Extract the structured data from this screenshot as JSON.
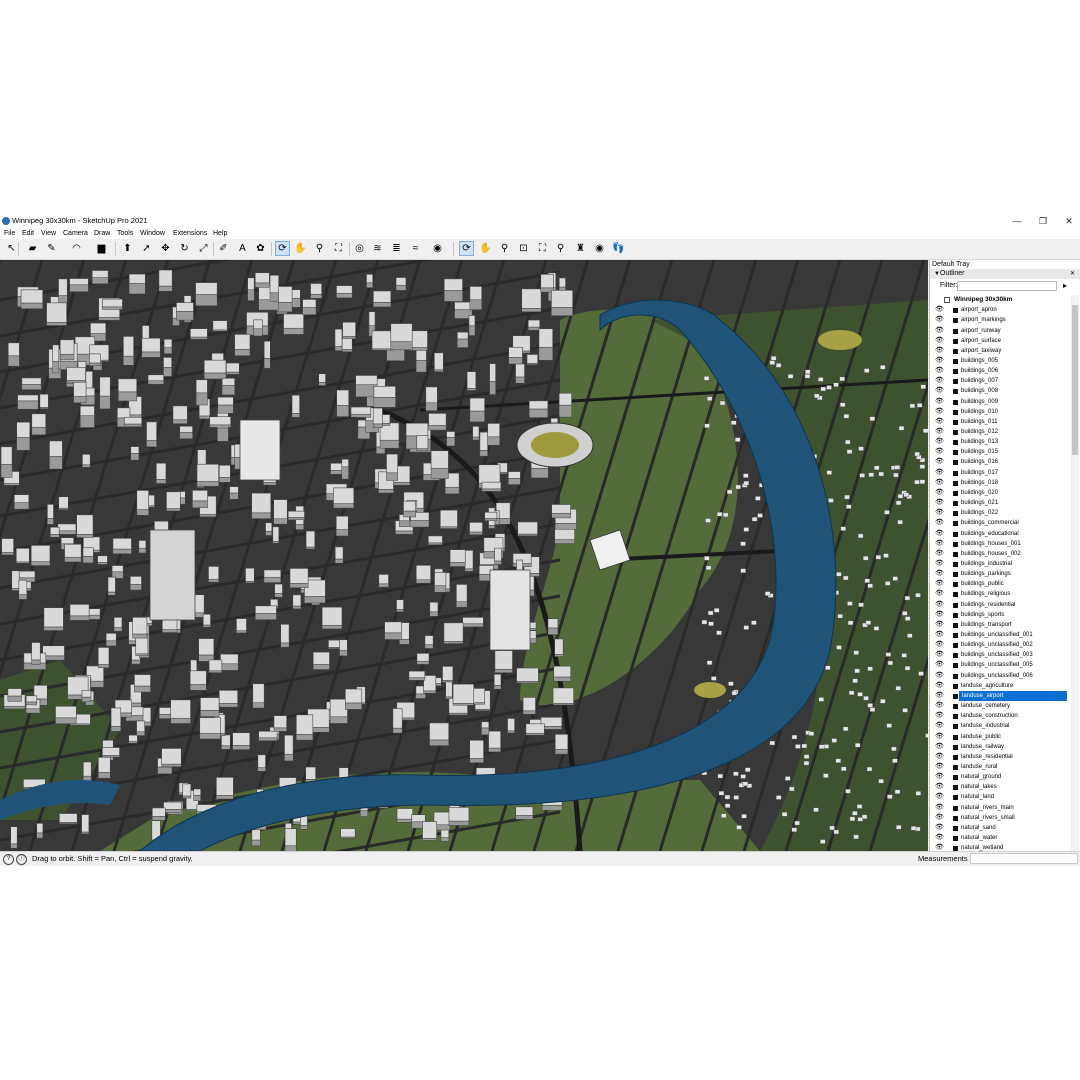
{
  "window": {
    "title": "Winnipeg 30x30km - SketchUp Pro 2021",
    "minimize_glyph": "—",
    "maximize_glyph": "❐",
    "close_glyph": "✕"
  },
  "menu": [
    "File",
    "Edit",
    "View",
    "Camera",
    "Draw",
    "Tools",
    "Window",
    "Extensions",
    "Help"
  ],
  "toolbar": {
    "tools": [
      {
        "name": "select-icon",
        "glyph": "↖"
      },
      {
        "name": "eraser-icon",
        "glyph": "▰"
      },
      {
        "name": "pencil-icon",
        "glyph": "✎"
      },
      {
        "name": "arc-icon",
        "glyph": "◠"
      },
      {
        "name": "rectangle-icon",
        "glyph": "▆"
      },
      {
        "name": "push-pull-icon",
        "glyph": "⬆"
      },
      {
        "name": "follow-me-icon",
        "glyph": "➚"
      },
      {
        "name": "move-icon",
        "glyph": "✥"
      },
      {
        "name": "rotate-icon",
        "glyph": "↻"
      },
      {
        "name": "scale-icon",
        "glyph": "⤢"
      },
      {
        "name": "tape-measure-icon",
        "glyph": "✐"
      },
      {
        "name": "text-icon",
        "glyph": "A"
      },
      {
        "name": "paint-bucket-icon",
        "glyph": "✿"
      },
      {
        "name": "orbit-icon",
        "glyph": "⟳"
      },
      {
        "name": "pan-icon",
        "glyph": "✋"
      },
      {
        "name": "zoom-icon",
        "glyph": "⚲"
      },
      {
        "name": "zoom-extents-icon",
        "glyph": "⛶"
      },
      {
        "name": "add-location-icon",
        "glyph": "◎"
      },
      {
        "name": "terrain-icon",
        "glyph": "≋"
      },
      {
        "name": "layers-icon",
        "glyph": "≣"
      },
      {
        "name": "geo-icon",
        "glyph": "≈"
      },
      {
        "name": "warehouse-icon",
        "glyph": "◉"
      },
      {
        "name": "orbit-view-icon",
        "glyph": "⟳"
      },
      {
        "name": "pan-view-icon",
        "glyph": "✋"
      },
      {
        "name": "zoom-view-icon",
        "glyph": "⚲"
      },
      {
        "name": "zoom-window-icon",
        "glyph": "⊡"
      },
      {
        "name": "zoom-extents-view-icon",
        "glyph": "⛶"
      },
      {
        "name": "previous-view-icon",
        "glyph": "⚲"
      },
      {
        "name": "position-camera-icon",
        "glyph": "♜"
      },
      {
        "name": "look-around-icon",
        "glyph": "◉"
      },
      {
        "name": "walk-icon",
        "glyph": "👣"
      }
    ]
  },
  "status": {
    "hint": "Drag to orbit. Shift = Pan, Ctrl = suspend gravity.",
    "info_glyph": "?",
    "geo_glyph": "ⓘ",
    "measurements_label": "Measurements"
  },
  "tray": {
    "title": "Default Tray",
    "panel_title": "Outliner",
    "collapse_glyph": "▼",
    "close_glyph": "✕",
    "filter_label": "Filter:",
    "filter_value": "",
    "filter_btn_glyph": "▸",
    "root": "Winnipeg 30x30km",
    "selected_index": 38,
    "items": [
      "airport_apron",
      "airport_markings",
      "airport_runway",
      "airport_surface",
      "airport_taxiway",
      "buildings_005",
      "buildings_006",
      "buildings_007",
      "buildings_008",
      "buildings_009",
      "buildings_010",
      "buildings_011",
      "buildings_012",
      "buildings_013",
      "buildings_015",
      "buildings_016",
      "buildings_017",
      "buildings_018",
      "buildings_020",
      "buildings_021",
      "buildings_022",
      "buildings_commercial",
      "buildings_educational",
      "buildings_houses_001",
      "buildings_houses_002",
      "buildings_industrial",
      "buildings_parkings",
      "buildings_public",
      "buildings_religious",
      "buildings_residential",
      "buildings_sports",
      "buildings_transport",
      "buildings_unclassified_001",
      "buildings_unclassified_002",
      "buildings_unclassified_003",
      "buildings_unclassified_005",
      "buildings_unclassified_006",
      "landuse_agriculture",
      "landuse_airport",
      "landuse_cemetery",
      "landuse_construction",
      "landuse_industrial",
      "landuse_public",
      "landuse_railway",
      "landuse_residential",
      "landuse_rural",
      "natural_ground",
      "natural_lakes",
      "natural_land",
      "natural_rivers_main",
      "natural_rivers_small",
      "natural_sand",
      "natural_water",
      "natural_wetland"
    ]
  },
  "colors": {
    "river": "#1f5478",
    "grass": "#556b3a",
    "grass_dark": "#3e5230",
    "road": "#2a2a2a",
    "building": "#d9d9d9",
    "building_dark": "#9a9a9a",
    "selection": "#0a6fd1"
  }
}
